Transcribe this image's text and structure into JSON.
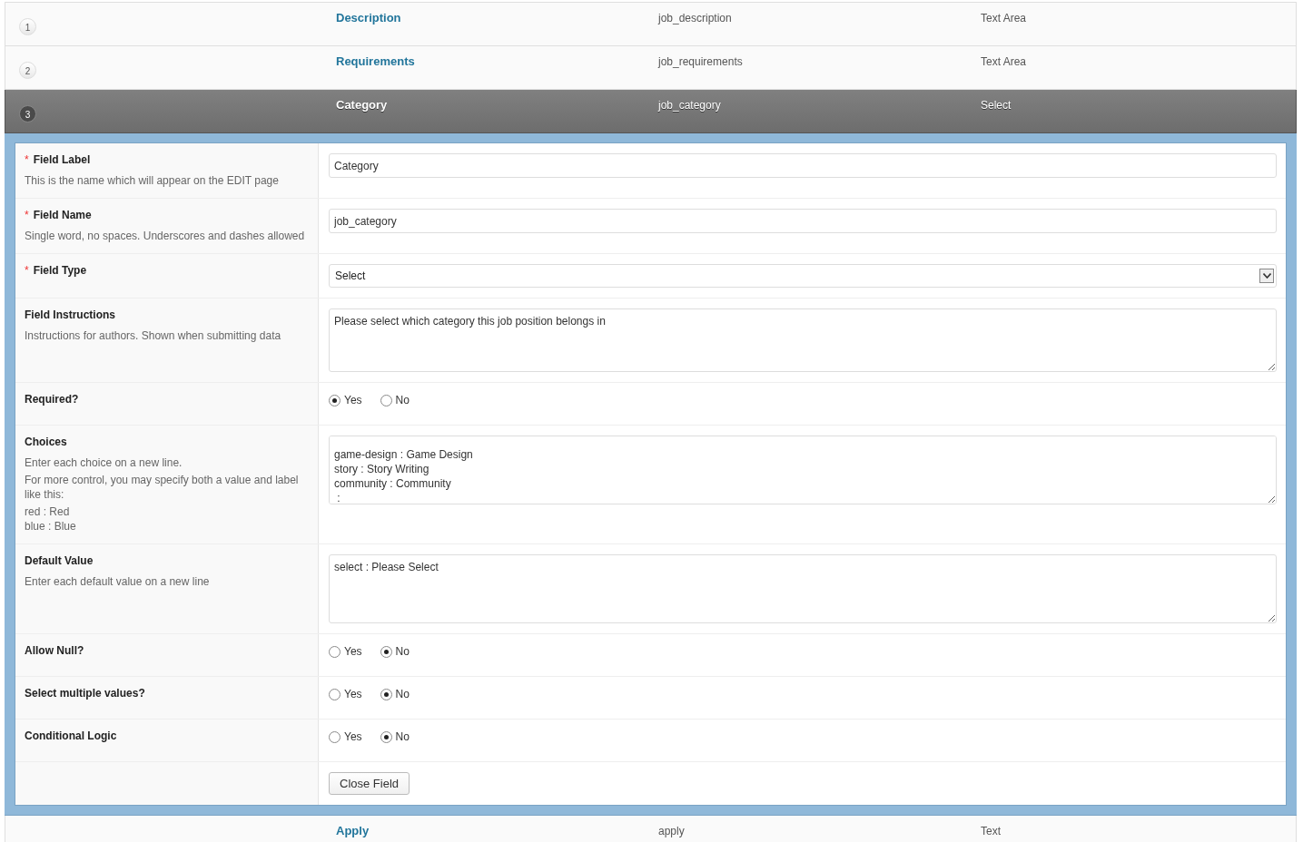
{
  "fields": [
    {
      "number": "1",
      "label": "Description",
      "name": "job_description",
      "type": "Text Area",
      "selected": false
    },
    {
      "number": "2",
      "label": "Requirements",
      "name": "job_requirements",
      "type": "Text Area",
      "selected": false
    },
    {
      "number": "3",
      "label": "Category",
      "name": "job_category",
      "type": "Select",
      "selected": true
    },
    {
      "label": "Apply",
      "name": "apply",
      "type": "Text",
      "selected": false
    }
  ],
  "editor": {
    "rows": [
      {
        "kind": "text",
        "marker": "*",
        "label": "Field Label",
        "descriptions": [
          "This is the name which will appear on the EDIT page"
        ],
        "value": "Category"
      },
      {
        "kind": "text",
        "marker": "*",
        "label": "Field Name",
        "descriptions": [
          "Single word, no spaces. Underscores and dashes allowed"
        ],
        "value": "job_category"
      },
      {
        "kind": "select",
        "marker": "*",
        "label": "Field Type",
        "value": "Select"
      },
      {
        "kind": "textarea",
        "label": "Field Instructions",
        "descriptions": [
          "Instructions for authors. Shown when submitting data"
        ],
        "value": "Please select which category this job position belongs in"
      },
      {
        "kind": "radio",
        "label": "Required?",
        "options": [
          {
            "label": "Yes",
            "selected": true
          },
          {
            "label": "No",
            "selected": false
          }
        ]
      },
      {
        "kind": "choices",
        "label": "Choices",
        "descriptions": [
          "Enter each choice on a new line.",
          "For more control, you may specify both a value and label like this:",
          "red : Red\nblue : Blue"
        ],
        "value": "game-design : Game Design\nstory : Story Writing\ncommunity : Community\n : "
      },
      {
        "kind": "textarea",
        "label": "Default Value",
        "descriptions": [
          "Enter each default value on a new line"
        ],
        "value": "select : Please Select"
      },
      {
        "kind": "radio",
        "label": "Allow Null?",
        "options": [
          {
            "label": "Yes",
            "selected": false
          },
          {
            "label": "No",
            "selected": true
          }
        ]
      },
      {
        "kind": "radio",
        "label": "Select multiple values?",
        "options": [
          {
            "label": "Yes",
            "selected": false
          },
          {
            "label": "No",
            "selected": true
          }
        ]
      },
      {
        "kind": "radio",
        "label": "Conditional Logic",
        "options": [
          {
            "label": "Yes",
            "selected": false
          },
          {
            "label": "No",
            "selected": true
          }
        ]
      },
      {
        "kind": "button",
        "label": "Close Field"
      }
    ]
  }
}
